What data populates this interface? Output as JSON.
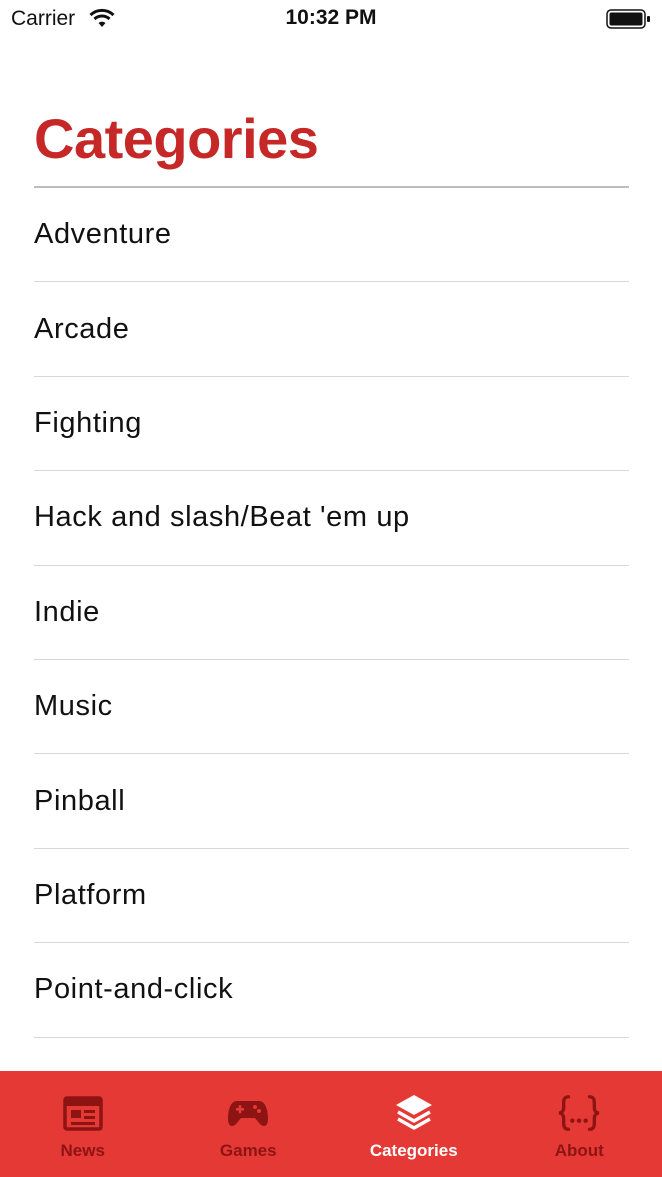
{
  "status_bar": {
    "carrier": "Carrier",
    "time": "10:32 PM",
    "wifi_icon": "wifi-icon",
    "battery_icon": "battery-icon"
  },
  "page": {
    "title": "Categories",
    "accent_color": "#c62828"
  },
  "categories": [
    {
      "label": "Adventure"
    },
    {
      "label": "Arcade"
    },
    {
      "label": "Fighting"
    },
    {
      "label": "Hack and slash/Beat 'em up"
    },
    {
      "label": "Indie"
    },
    {
      "label": "Music"
    },
    {
      "label": "Pinball"
    },
    {
      "label": "Platform"
    },
    {
      "label": "Point-and-click"
    }
  ],
  "tab_bar": {
    "background_color": "#e53935",
    "inactive_color": "#8e1414",
    "active_color": "#ffffff",
    "tabs": [
      {
        "label": "News",
        "icon": "newspaper-icon",
        "active": false
      },
      {
        "label": "Games",
        "icon": "gamepad-icon",
        "active": false
      },
      {
        "label": "Categories",
        "icon": "layers-icon",
        "active": true
      },
      {
        "label": "About",
        "icon": "braces-icon",
        "active": false
      }
    ]
  }
}
